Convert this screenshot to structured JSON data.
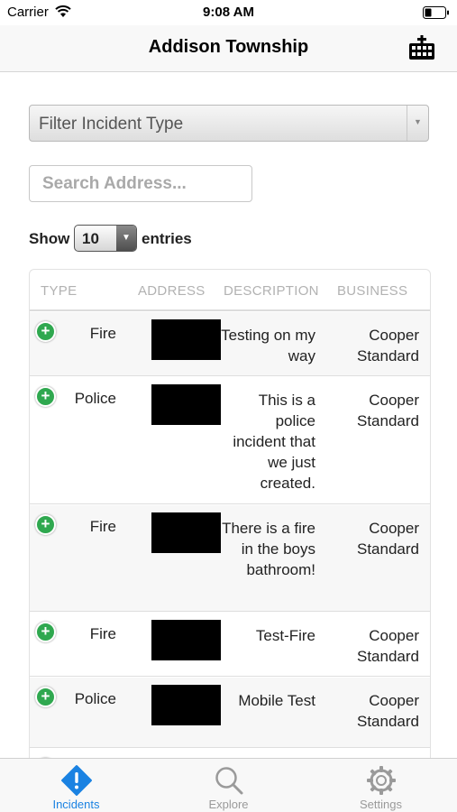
{
  "status_bar": {
    "carrier": "Carrier",
    "time": "9:08 AM"
  },
  "nav": {
    "title": "Addison Township",
    "action_icon": "calendar-grid-icon"
  },
  "filter": {
    "placeholder": "Filter Incident Type"
  },
  "search": {
    "placeholder": "Search Address..."
  },
  "show_entries": {
    "show_label": "Show",
    "value": "10",
    "entries_label": "entries"
  },
  "table": {
    "columns": [
      "TYPE",
      "ADDRESS",
      "DESCRIPTION",
      "BUSINESS"
    ],
    "rows": [
      {
        "type": "Fire",
        "description": "Testing on my way",
        "business": "Cooper Standard"
      },
      {
        "type": "Police",
        "description": "This is a police incident that we just created.",
        "business": "Cooper Standard"
      },
      {
        "type": "Fire",
        "description": "There is a fire in the boys bathroom!",
        "business": "Cooper Standard"
      },
      {
        "type": "Fire",
        "description": "Test-Fire",
        "business": "Cooper Standard"
      },
      {
        "type": "Police",
        "description": "Mobile Test",
        "business": "Cooper Standard"
      }
    ]
  },
  "tabs": [
    {
      "label": "Incidents",
      "icon": "alert-diamond-icon",
      "active": true
    },
    {
      "label": "Explore",
      "icon": "magnifier-icon",
      "active": false
    },
    {
      "label": "Settings",
      "icon": "gear-icon",
      "active": false
    }
  ],
  "colors": {
    "accent": "#1a82e2",
    "inactive": "#9a9a9a",
    "add_button": "#2fa84f"
  }
}
